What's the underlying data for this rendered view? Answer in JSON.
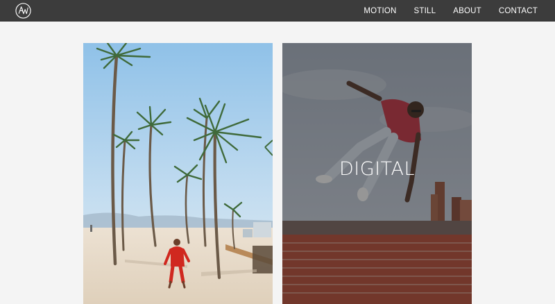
{
  "header": {
    "logo_icon": "aw-monogram-icon",
    "nav": {
      "motion": "MOTION",
      "still": "STILL",
      "about": "ABOUT",
      "contact": "CONTACT"
    }
  },
  "gallery": {
    "tiles": [
      {
        "caption": ""
      },
      {
        "caption": "DIGITAL"
      }
    ]
  },
  "colors": {
    "nav_background": "#3c3c3c",
    "page_background": "#f4f4f4",
    "nav_text": "#ffffff"
  }
}
